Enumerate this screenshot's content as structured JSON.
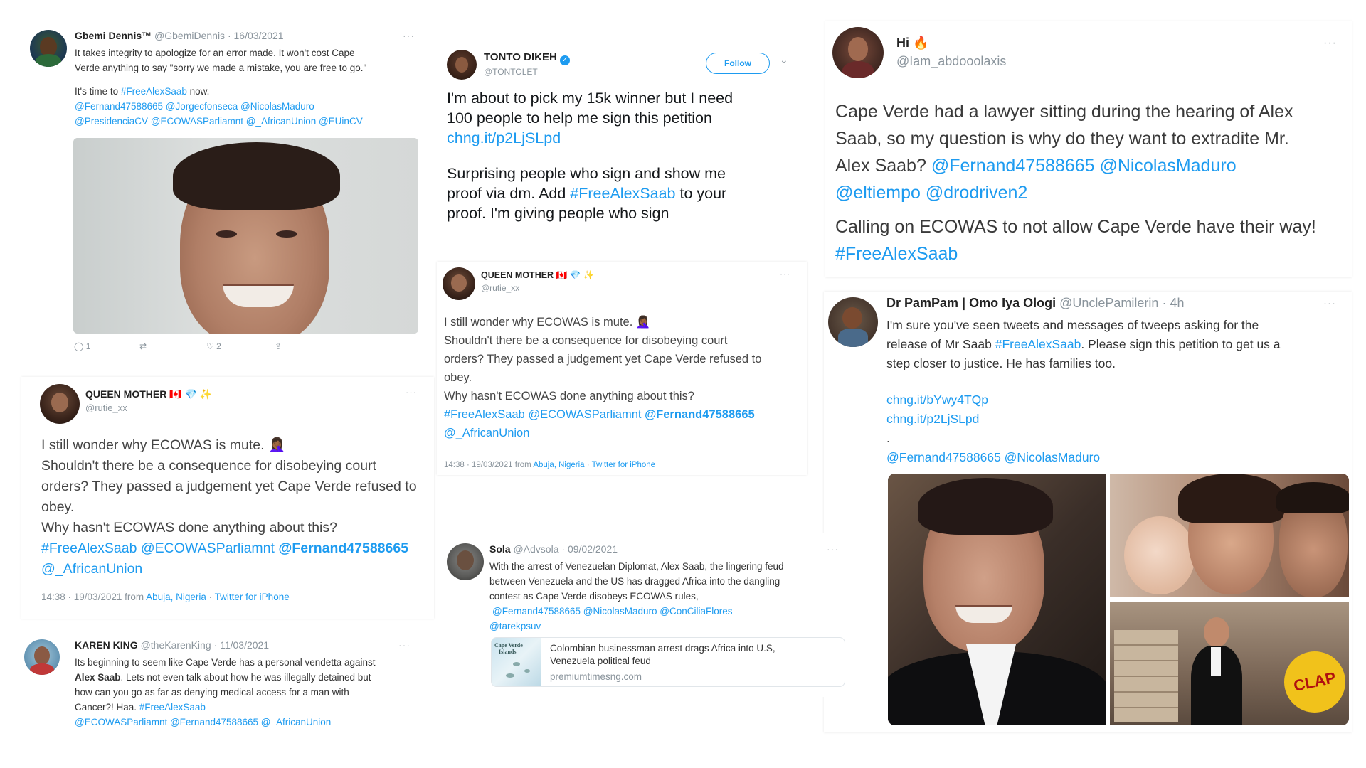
{
  "tweet_gbemi": {
    "name": "Gbemi Dennis™",
    "handle": "@GbemiDennis",
    "date": "· 16/03/2021",
    "line1": "It takes integrity to apologize for an error made. It won't cost Cape",
    "line2": "Verde anything to say \"sorry we made a mistake, you are free to go.\"",
    "line3a": "It's time to ",
    "line3b": "#FreeAlexSaab",
    "line3c": " now.",
    "mentions1": "@Fernand47588665 @Jorgecfonseca @NicolasMaduro",
    "mentions2": "@PresidenciaCV @ECOWASParliamnt @_AfricanUnion @EUinCV",
    "replies": "1",
    "likes": "2"
  },
  "tweet_tonto": {
    "name": "TONTO DIKEH",
    "handle": "@TONTOLET",
    "follow": "Follow",
    "line1": "I'm about to pick my 15k winner but I need",
    "line2": "100 people to help me sign this petition",
    "link": "chng.it/p2LjSLpd",
    "line3": "Surprising people who sign and show me",
    "line4a": "proof via dm. Add ",
    "line4b": "#FreeAlexSaab",
    "line4c": " to your",
    "line5": "proof. I'm giving people who sign"
  },
  "tweet_hi": {
    "name": "Hi 🔥",
    "handle": "@Iam_abdooolaxis",
    "line1": "Cape Verde had a lawyer sitting during the hearing of Alex",
    "line2": "Saab, so my question is why do they want to extradite Mr.",
    "line3a": "Alex Saab? ",
    "line3b": "@Fernand47588665 @NicolasMaduro",
    "line4": "@eltiempo @drodriven2",
    "line5": "Calling on ECOWAS to not allow Cape Verde have their way!",
    "line6": "#FreeAlexSaab"
  },
  "tweet_queen_small": {
    "name": "QUEEN MOTHER 🇨🇦 💎 ✨",
    "handle": "@rutie_xx",
    "line1": "I still wonder why ECOWAS is mute. 🤦🏾‍♀️",
    "line2": "Shouldn't there be a consequence for disobeying court",
    "line3": "orders? They passed a judgement yet Cape Verde refused to",
    "line4": "obey.",
    "line5": "Why hasn't ECOWAS done anything about this?",
    "tags1": "#FreeAlexSaab @ECOWASParliamnt ",
    "tags1b": "@Fernand47588665",
    "tags2": "@_AfricanUnion",
    "meta_time": "14:38 · 19/03/2021 from ",
    "meta_place": "Abuja, Nigeria",
    "meta_sep": " · ",
    "meta_client": "Twitter for iPhone"
  },
  "tweet_queen_large": {
    "name": "QUEEN MOTHER 🇨🇦 💎 ✨",
    "handle": "@rutie_xx",
    "line1": "I still wonder why ECOWAS is mute. 🤦🏾‍♀️",
    "line2": "Shouldn't there be a consequence for disobeying court",
    "line3": "orders? They passed a judgement yet Cape Verde refused to",
    "line4": "obey.",
    "line5": "Why hasn't ECOWAS done anything about this?",
    "tags1": "#FreeAlexSaab @ECOWASParliamnt ",
    "tags1b": "@Fernand47588665",
    "tags2": "@_AfricanUnion",
    "meta_time": "14:38 · 19/03/2021 from ",
    "meta_place": "Abuja, Nigeria",
    "meta_sep": " · ",
    "meta_client": "Twitter for iPhone"
  },
  "tweet_pampam": {
    "name": "Dr PamPam | Omo Iya Ologi",
    "handle": "@UnclePamilerin",
    "time": "· 4h",
    "line1": "I'm sure you've seen tweets and messages of tweeps asking for the",
    "line2a": "release of Mr Saab ",
    "line2b": "#FreeAlexSaab",
    "line2c": ". Please sign this petition to get us a",
    "line3": "step closer to justice. He has families too.",
    "link1": "chng.it/bYwy4TQp",
    "link2": "chng.it/p2LjSLpd",
    "dot": ".",
    "mentions": "@Fernand47588665 @NicolasMaduro",
    "stamp": "CLAP"
  },
  "tweet_sola": {
    "name": "Sola",
    "handle": "@Advsola",
    "date": "· 09/02/2021",
    "line1": "With the arrest of Venezuelan Diplomat, Alex Saab, the lingering feud",
    "line2": "between Venezuela and the US has dragged Africa into the dangling",
    "line3": "contest as Cape Verde disobeys ECOWAS rules,",
    "mentions1": "@Fernand47588665 @NicolasMaduro @ConCiliaFlores",
    "mentions2": "@tarekpsuv",
    "card_map_label1": "Cape Verde",
    "card_map_label2": "Islands",
    "card_title1": "Colombian businessman arrest drags Africa into U.S,",
    "card_title2": "Venezuela political feud",
    "card_domain": "premiumtimesng.com"
  },
  "tweet_karen": {
    "name": "KAREN KING",
    "handle": "@theKarenKing",
    "date": "· 11/03/2021",
    "line1": "Its beginning to seem like Cape Verde has a personal vendetta against",
    "line2a": "Alex Saab",
    "line2b": ". Lets not even talk about how he was illegally detained but",
    "line3": "how can you go as far as denying medical access for a man with",
    "line4a": "Cancer?! Haa. ",
    "line4b": "#FreeAlexSaab",
    "line5": "@ECOWASParliamnt @Fernand47588665 @_AfricanUnion"
  }
}
